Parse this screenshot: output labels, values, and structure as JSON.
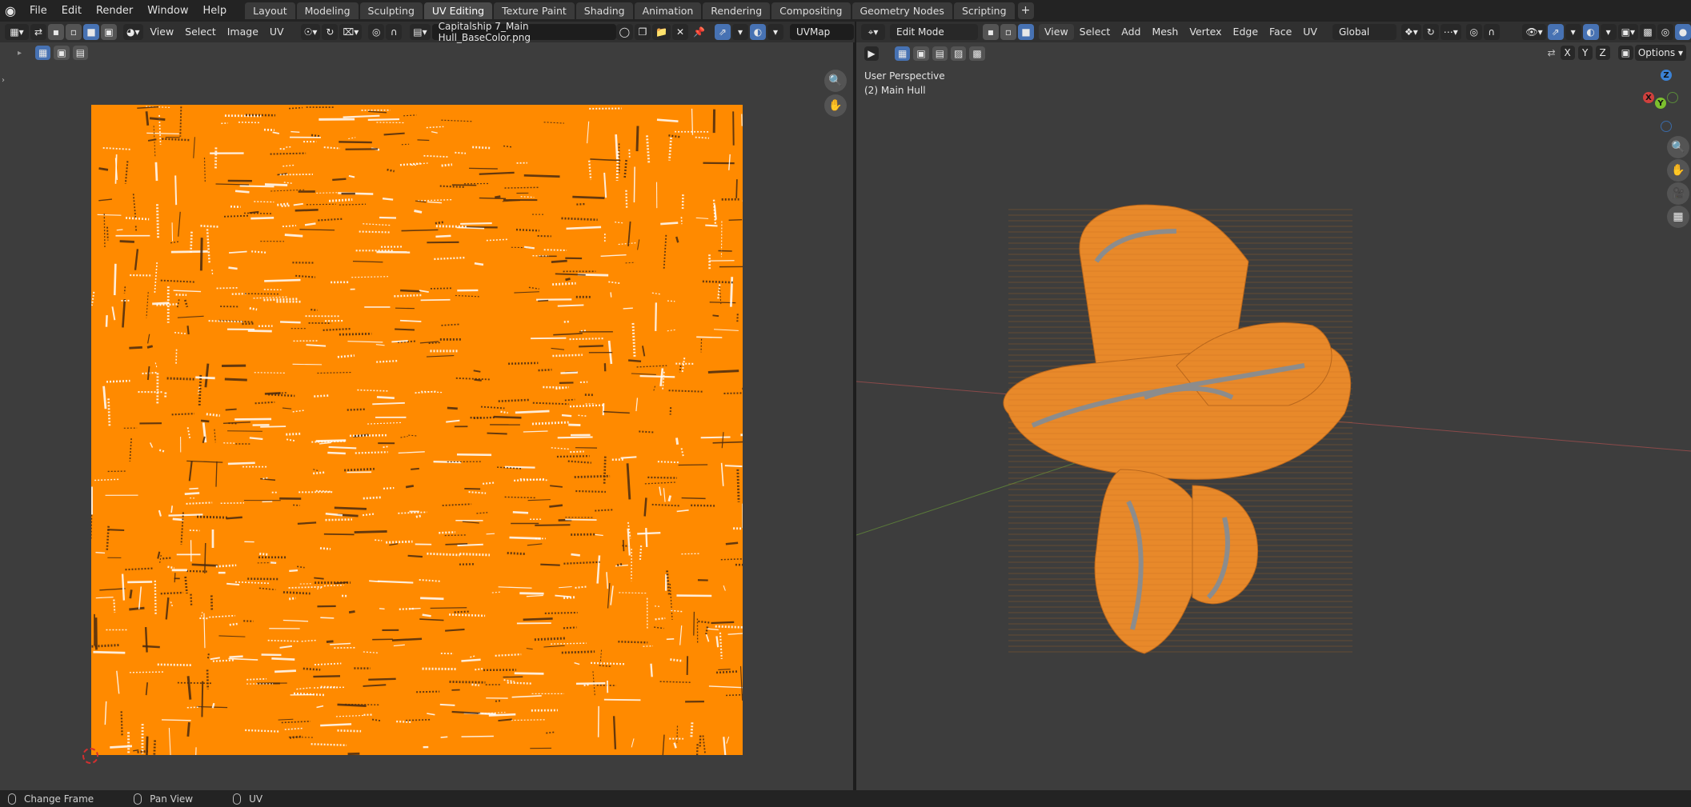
{
  "app": {
    "menu": [
      "File",
      "Edit",
      "Render",
      "Window",
      "Help"
    ],
    "workspace_tabs": [
      "Layout",
      "Modeling",
      "Sculpting",
      "UV Editing",
      "Texture Paint",
      "Shading",
      "Animation",
      "Rendering",
      "Compositing",
      "Geometry Nodes",
      "Scripting"
    ],
    "active_tab": "UV Editing"
  },
  "uv_editor": {
    "menus": [
      "View",
      "Select",
      "Image",
      "UV"
    ],
    "image_name": "Capitalship 7_Main Hull_BaseColor.png",
    "uv_map": "UVMap",
    "texture_color": "#ff8a00"
  },
  "viewport": {
    "mode": "Edit Mode",
    "menus": [
      "View",
      "Select",
      "Add",
      "Mesh",
      "Vertex",
      "Edge",
      "Face",
      "UV"
    ],
    "transform_orientation": "Global",
    "perspective_label": "User Perspective",
    "object_label": "(2) Main Hull",
    "axis_labels": [
      "X",
      "Y",
      "Z"
    ],
    "options_label": "Options",
    "mesh_color": "#e8892a"
  },
  "statusbar": {
    "items": [
      "Change Frame",
      "Pan View",
      "UV"
    ]
  }
}
